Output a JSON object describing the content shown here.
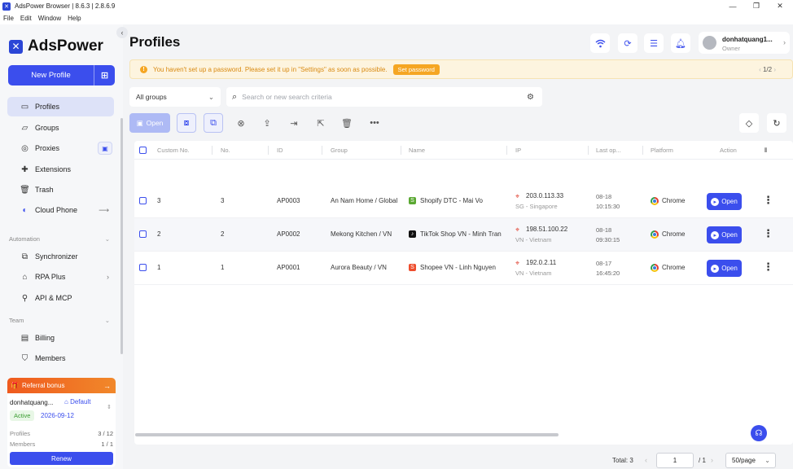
{
  "window": {
    "title": "AdsPower Browser | 8.6.3 | 2.8.6.9",
    "controls": [
      "—",
      "❐",
      "✕"
    ]
  },
  "menu": [
    "File",
    "Edit",
    "Window",
    "Help"
  ],
  "sidebar": {
    "logo_text": "AdsPower",
    "new_profile_label": "New Profile",
    "items_main": [
      {
        "label": "Profiles",
        "icon": "profiles-icon"
      },
      {
        "label": "Groups",
        "icon": "groups-icon"
      },
      {
        "label": "Proxies",
        "icon": "proxies-icon"
      },
      {
        "label": "Extensions",
        "icon": "extensions-icon"
      },
      {
        "label": "Trash",
        "icon": "trash-icon"
      },
      {
        "label": "Cloud Phone",
        "icon": "cloud-phone-icon"
      }
    ],
    "section_automation": "Automation",
    "items_automation": [
      {
        "label": "Synchronizer",
        "icon": "synchronizer-icon"
      },
      {
        "label": "RPA Plus",
        "icon": "rpa-icon"
      },
      {
        "label": "API & MCP",
        "icon": "api-icon"
      }
    ],
    "section_team": "Team",
    "items_team": [
      {
        "label": "Billing",
        "icon": "billing-icon"
      },
      {
        "label": "Members",
        "icon": "members-icon"
      }
    ],
    "referral": {
      "title": "Referral bonus",
      "account": "donhatquang...",
      "default_label": "Default",
      "status": "Active",
      "expiry": "2026-09-12",
      "profiles_label": "Profiles",
      "profiles_value": "3 / 12",
      "members_label": "Members",
      "members_value": "1 / 1",
      "renew_label": "Renew"
    }
  },
  "header": {
    "title": "Profiles",
    "user_name": "donhatquang1...",
    "user_role": "Owner"
  },
  "alert": {
    "message": "You haven't set up a password. Please set it up in \"Settings\" as soon as possible.",
    "button": "Set password",
    "pager": "1/2"
  },
  "filters": {
    "group_select": "All groups",
    "search_placeholder": "Search or new search criteria"
  },
  "toolbar": {
    "open_label": "Open"
  },
  "table": {
    "columns": [
      "Custom No.",
      "No.",
      "ID",
      "Group",
      "Name",
      "IP",
      "Last op...",
      "Platform",
      "Action"
    ],
    "rows": [
      {
        "custom_no": "3",
        "no": "3",
        "id": "AP0003",
        "group": "An Nam Home / Global",
        "name": "Shopify DTC - Mai Vo",
        "name_icon": "shopify-icon",
        "ip": "203.0.113.33",
        "ip_loc": "SG - Singapore",
        "date": "08-18",
        "time": "10:15:30",
        "platform": "Chrome",
        "action": "Open"
      },
      {
        "custom_no": "2",
        "no": "2",
        "id": "AP0002",
        "group": "Mekong Kitchen / VN",
        "name": "TikTok Shop VN - Minh Tran",
        "name_icon": "tiktok-icon",
        "ip": "198.51.100.22",
        "ip_loc": "VN - Vietnam",
        "date": "08-18",
        "time": "09:30:15",
        "platform": "Chrome",
        "action": "Open"
      },
      {
        "custom_no": "1",
        "no": "1",
        "id": "AP0001",
        "group": "Aurora Beauty / VN",
        "name": "Shopee VN - Linh Nguyen",
        "name_icon": "shopee-icon",
        "ip": "192.0.2.11",
        "ip_loc": "VN - Vietnam",
        "date": "08-17",
        "time": "16:45:20",
        "platform": "Chrome",
        "action": "Open"
      }
    ]
  },
  "footer": {
    "total": "Total: 3",
    "page": "1",
    "of": "/ 1",
    "per_page": "50/page"
  },
  "colors": {
    "accent": "#3b4eed",
    "warning": "#f5a623",
    "referral": "#ef5a1e"
  }
}
